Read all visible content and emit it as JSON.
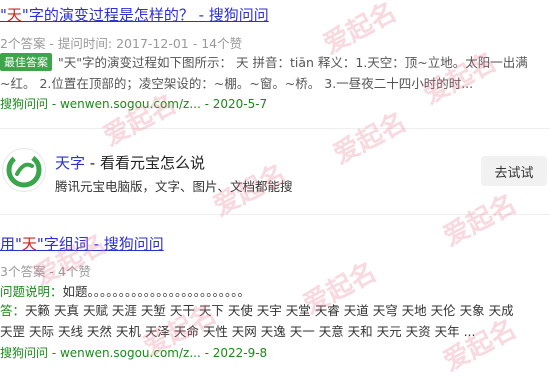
{
  "result1": {
    "title_prefix": "\"",
    "title_hl": "天",
    "title_rest": "\"字的演变过程是怎样的？ - 搜狗问问",
    "meta": "2个答案 - 提问时间: 2017-12-01 - 14个赞",
    "badge": "最佳答案",
    "snippet1": "\"天\"字的演变过程如下图所示： 天 拼音：tiān 释义：1.天空：顶~立地。太阳一出满",
    "snippet2": "~红。 2.位置在顶部的；凌空架设的：~棚。~窗。~桥。 3.一昼夜二十四小时的时...",
    "source": "搜狗问问 - wenwen.sogou.com/z... - 2020-5-7"
  },
  "app": {
    "icon": "yuanbao-logo-icon",
    "title_link": "天字",
    "title_rest": " - 看看元宝怎么说",
    "desc": "腾讯元宝电脑版，文字、图片、文档都能搜",
    "button": "去试试"
  },
  "result2": {
    "title_a": "用\"",
    "title_hl": "天",
    "title_b": "\"字组词 - 搜狗问问",
    "meta": "3个答案 - 4个赞",
    "question_label": "问题说明：",
    "question_text": "如题。。。。。。。。。。。。。。。。。。。。。。。。。",
    "answer_label": "答：",
    "answer_line1": "天籁 天真 天赋 天涯 天堑 天干 天下 天使 天宇 天堂 天睿 天道 天穹 天地 天伦 天象 天成",
    "answer_line2": "天罡 天际 天线 天然 天机 天泽 天命 天性 天网 天逸 天一 天意 天和 天元 天资 天年 ...",
    "source": "搜狗问问 - wenwen.sogou.com/z... - 2022-9-8"
  },
  "watermark": "爱起名",
  "colors": {
    "link": "#2a2fd6",
    "highlight": "#d42020",
    "source": "#1a8a1a",
    "badge": "#3ea44a"
  }
}
